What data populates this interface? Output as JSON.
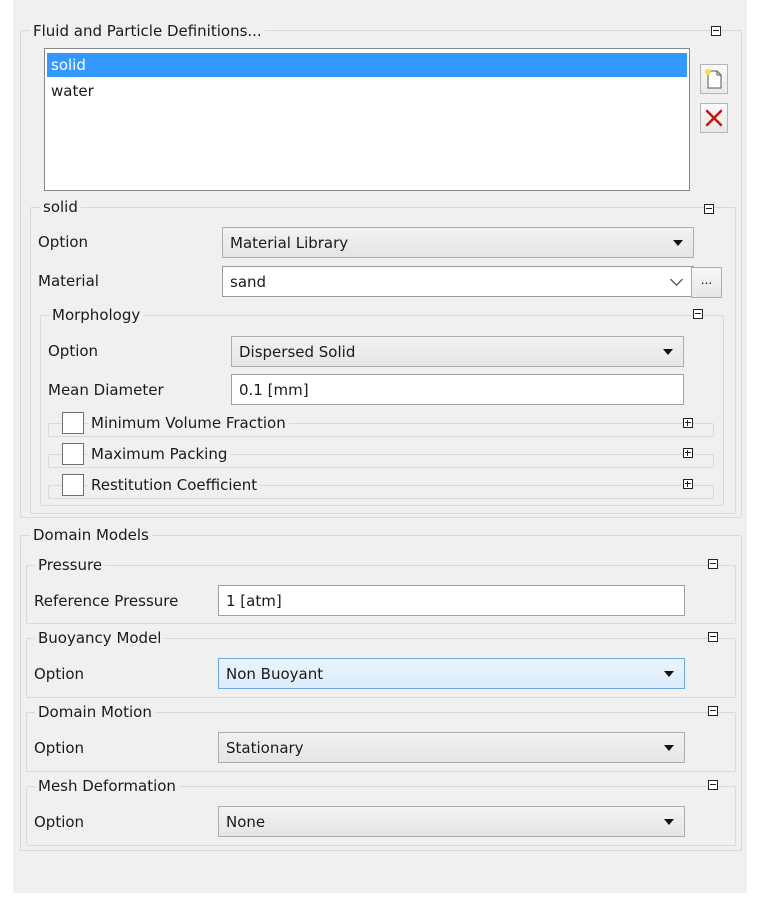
{
  "particle_defs": {
    "title": "Fluid and Particle Definitions...",
    "items": [
      "solid",
      "water"
    ],
    "selected": "solid",
    "new_icon": "new-document-icon",
    "delete_icon": "delete-x-icon"
  },
  "solid": {
    "title": "solid",
    "option_label": "Option",
    "option_value": "Material Library",
    "material_label": "Material",
    "material_value": "sand",
    "material_browse": "...",
    "morphology": {
      "title": "Morphology",
      "option_label": "Option",
      "option_value": "Dispersed Solid",
      "mean_diameter_label": "Mean Diameter",
      "mean_diameter_value": "0.1 [mm]",
      "min_volume_fraction": "Minimum Volume Fraction",
      "max_packing": "Maximum Packing",
      "restitution_coefficient": "Restitution Coefficient"
    }
  },
  "domain_models": {
    "title": "Domain Models",
    "pressure": {
      "title": "Pressure",
      "ref_label": "Reference Pressure",
      "ref_value": "1 [atm]"
    },
    "buoyancy": {
      "title": "Buoyancy Model",
      "option_label": "Option",
      "option_value": "Non Buoyant"
    },
    "motion": {
      "title": "Domain Motion",
      "option_label": "Option",
      "option_value": "Stationary"
    },
    "mesh": {
      "title": "Mesh Deformation",
      "option_label": "Option",
      "option_value": "None"
    }
  },
  "colors": {
    "selection": "#3399ff",
    "panel_bg": "#f0f0f0",
    "delete_red": "#cc1111"
  }
}
